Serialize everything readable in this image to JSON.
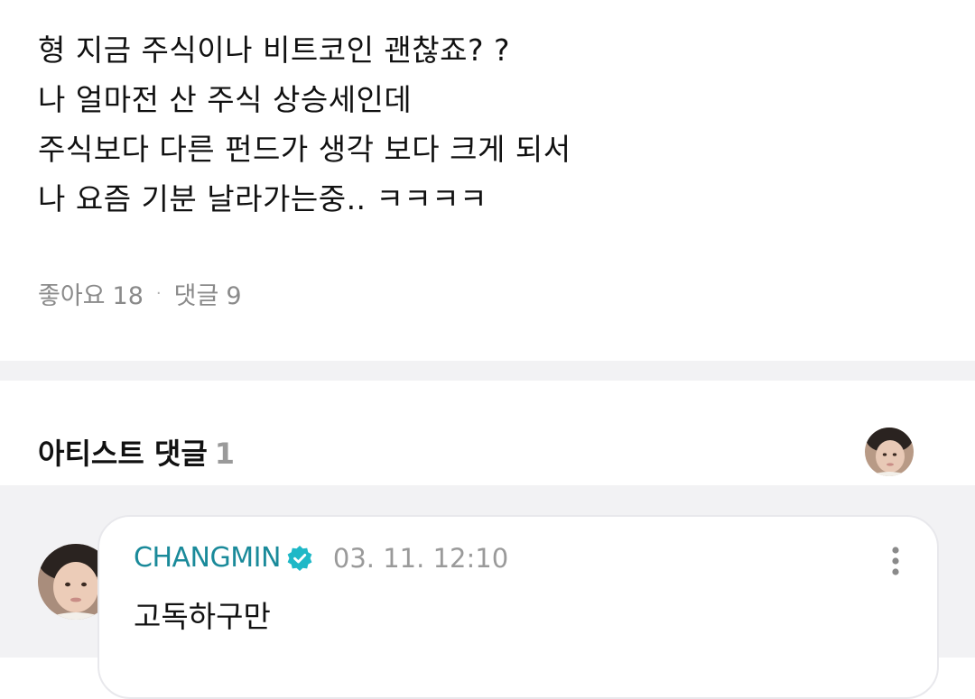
{
  "post": {
    "lines": [
      "형 지금 주식이나 비트코인 괜찮죠? ?",
      "나 얼마전 산 주식 상승세인데",
      "주식보다 다른 펀드가 생각 보다 크게 되서",
      "나 요즘 기분 날라가는중.. ㅋㅋㅋㅋ"
    ],
    "likes_label": "좋아요",
    "likes_count": "18",
    "separator": "·",
    "comments_label": "댓글",
    "comments_count": "9"
  },
  "artist_comments": {
    "title": "아티스트 댓글",
    "count": "1",
    "header_avatar_icon": "artist-profile-avatar"
  },
  "comment": {
    "author": "CHANGMIN",
    "verified_icon": "verified-badge-icon",
    "timestamp": "03. 11. 12:10",
    "text": "고독하구만",
    "menu_icon": "more-vertical-icon"
  },
  "colors": {
    "author": "#1a8a9a",
    "verified": "#1fb8c7",
    "muted": "#8a8a8a",
    "divider": "#f2f2f4"
  }
}
